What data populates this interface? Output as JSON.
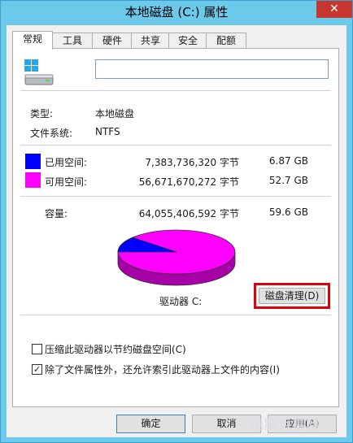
{
  "window": {
    "title": "本地磁盘 (C:) 属性",
    "close_symbol": "✕"
  },
  "tabs": [
    {
      "label": "常规",
      "active": true
    },
    {
      "label": "工具",
      "active": false
    },
    {
      "label": "硬件",
      "active": false
    },
    {
      "label": "共享",
      "active": false
    },
    {
      "label": "安全",
      "active": false
    },
    {
      "label": "配额",
      "active": false
    }
  ],
  "general": {
    "name_value": "",
    "type_label": "类型:",
    "type_value": "本地磁盘",
    "fs_label": "文件系统:",
    "fs_value": "NTFS",
    "used": {
      "label": "已用空间:",
      "bytes": "7,383,736,320 字节",
      "size": "6.87 GB",
      "color": "#0000ff"
    },
    "free": {
      "label": "可用空间:",
      "bytes": "56,671,670,272 字节",
      "size": "52.7 GB",
      "color": "#ff00ff"
    },
    "capacity": {
      "label": "容量:",
      "bytes": "64,055,406,592 字节",
      "size": "59.6 GB"
    },
    "drive_label": "驱动器 C:",
    "disk_cleanup_label": "磁盘清理(D)",
    "compress_label": "压缩此驱动器以节约磁盘空间(C)",
    "compress_checked": false,
    "index_label": "除了文件属性外，还允许索引此驱动器上文件的内容(I)",
    "index_checked": true,
    "used_fraction": 0.1153
  },
  "buttons": {
    "ok": "确定",
    "cancel": "取消",
    "apply": "应用(A)"
  },
  "watermark": "电脑百事网"
}
